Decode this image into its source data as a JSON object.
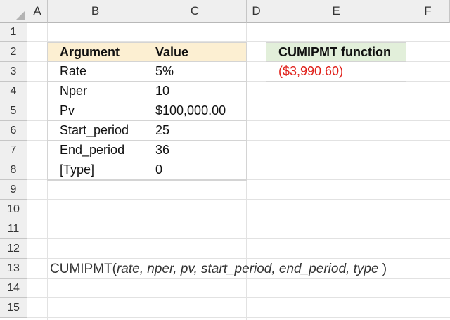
{
  "columns": [
    "A",
    "B",
    "C",
    "D",
    "E",
    "F"
  ],
  "rows": [
    "1",
    "2",
    "3",
    "4",
    "5",
    "6",
    "7",
    "8",
    "9",
    "10",
    "11",
    "12",
    "13",
    "14",
    "15"
  ],
  "table": {
    "header": {
      "argument": "Argument",
      "value": "Value"
    },
    "rows": [
      {
        "argument": "Rate",
        "value": "5%"
      },
      {
        "argument": "Nper",
        "value": "10"
      },
      {
        "argument": "Pv",
        "value": "$100,000.00"
      },
      {
        "argument": "Start_period",
        "value": "25"
      },
      {
        "argument": "End_period",
        "value": "36"
      },
      {
        "argument": "[Type]",
        "value": "0"
      }
    ]
  },
  "result": {
    "header": "CUMIPMT function",
    "value": "($3,990.60)"
  },
  "syntax": {
    "function_name": "CUMIPMT",
    "open_paren": "(",
    "args": "rate, nper, pv, start_period, end_period, type",
    "close_paren": " )"
  },
  "colors": {
    "table_header_bg": "#fcefd2",
    "result_header_bg": "#e2efda",
    "result_value": "#e0201a",
    "header_bg": "#efefef"
  }
}
